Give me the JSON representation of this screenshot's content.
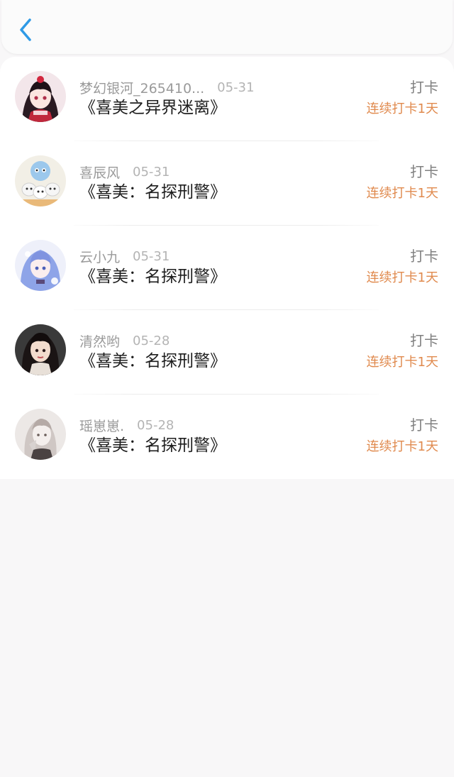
{
  "header": {
    "back_icon": "chevron-left-icon",
    "accent_color": "#2f9ae6"
  },
  "checkins": [
    {
      "username": "梦幻银河_265410...",
      "date": "05-31",
      "book": "《喜美之异界迷离》",
      "action": "打卡",
      "streak": "连续打卡1天",
      "avatar_icon": "anime-girl-red-dress-avatar"
    },
    {
      "username": "喜辰风",
      "date": "05-31",
      "book": "《喜美：名探刑警》",
      "action": "打卡",
      "streak": "连续打卡1天",
      "avatar_icon": "cartoon-characters-avatar"
    },
    {
      "username": "云小九",
      "date": "05-31",
      "book": "《喜美：名探刑警》",
      "action": "打卡",
      "streak": "连续打卡1天",
      "avatar_icon": "anime-girl-blue-hair-avatar"
    },
    {
      "username": "清然哟",
      "date": "05-28",
      "book": "《喜美：名探刑警》",
      "action": "打卡",
      "streak": "连续打卡1天",
      "avatar_icon": "portrait-dark-hair-avatar"
    },
    {
      "username": "瑶崽崽.",
      "date": "05-28",
      "book": "《喜美：名探刑警》",
      "action": "打卡",
      "streak": "连续打卡1天",
      "avatar_icon": "sketch-girl-avatar"
    }
  ],
  "colors": {
    "username": "#9a9a9a",
    "date": "#b4b4b4",
    "title": "#1e1e1e",
    "action": "#808080",
    "streak": "#e08a4e",
    "page_bg": "#f8f7f8"
  }
}
